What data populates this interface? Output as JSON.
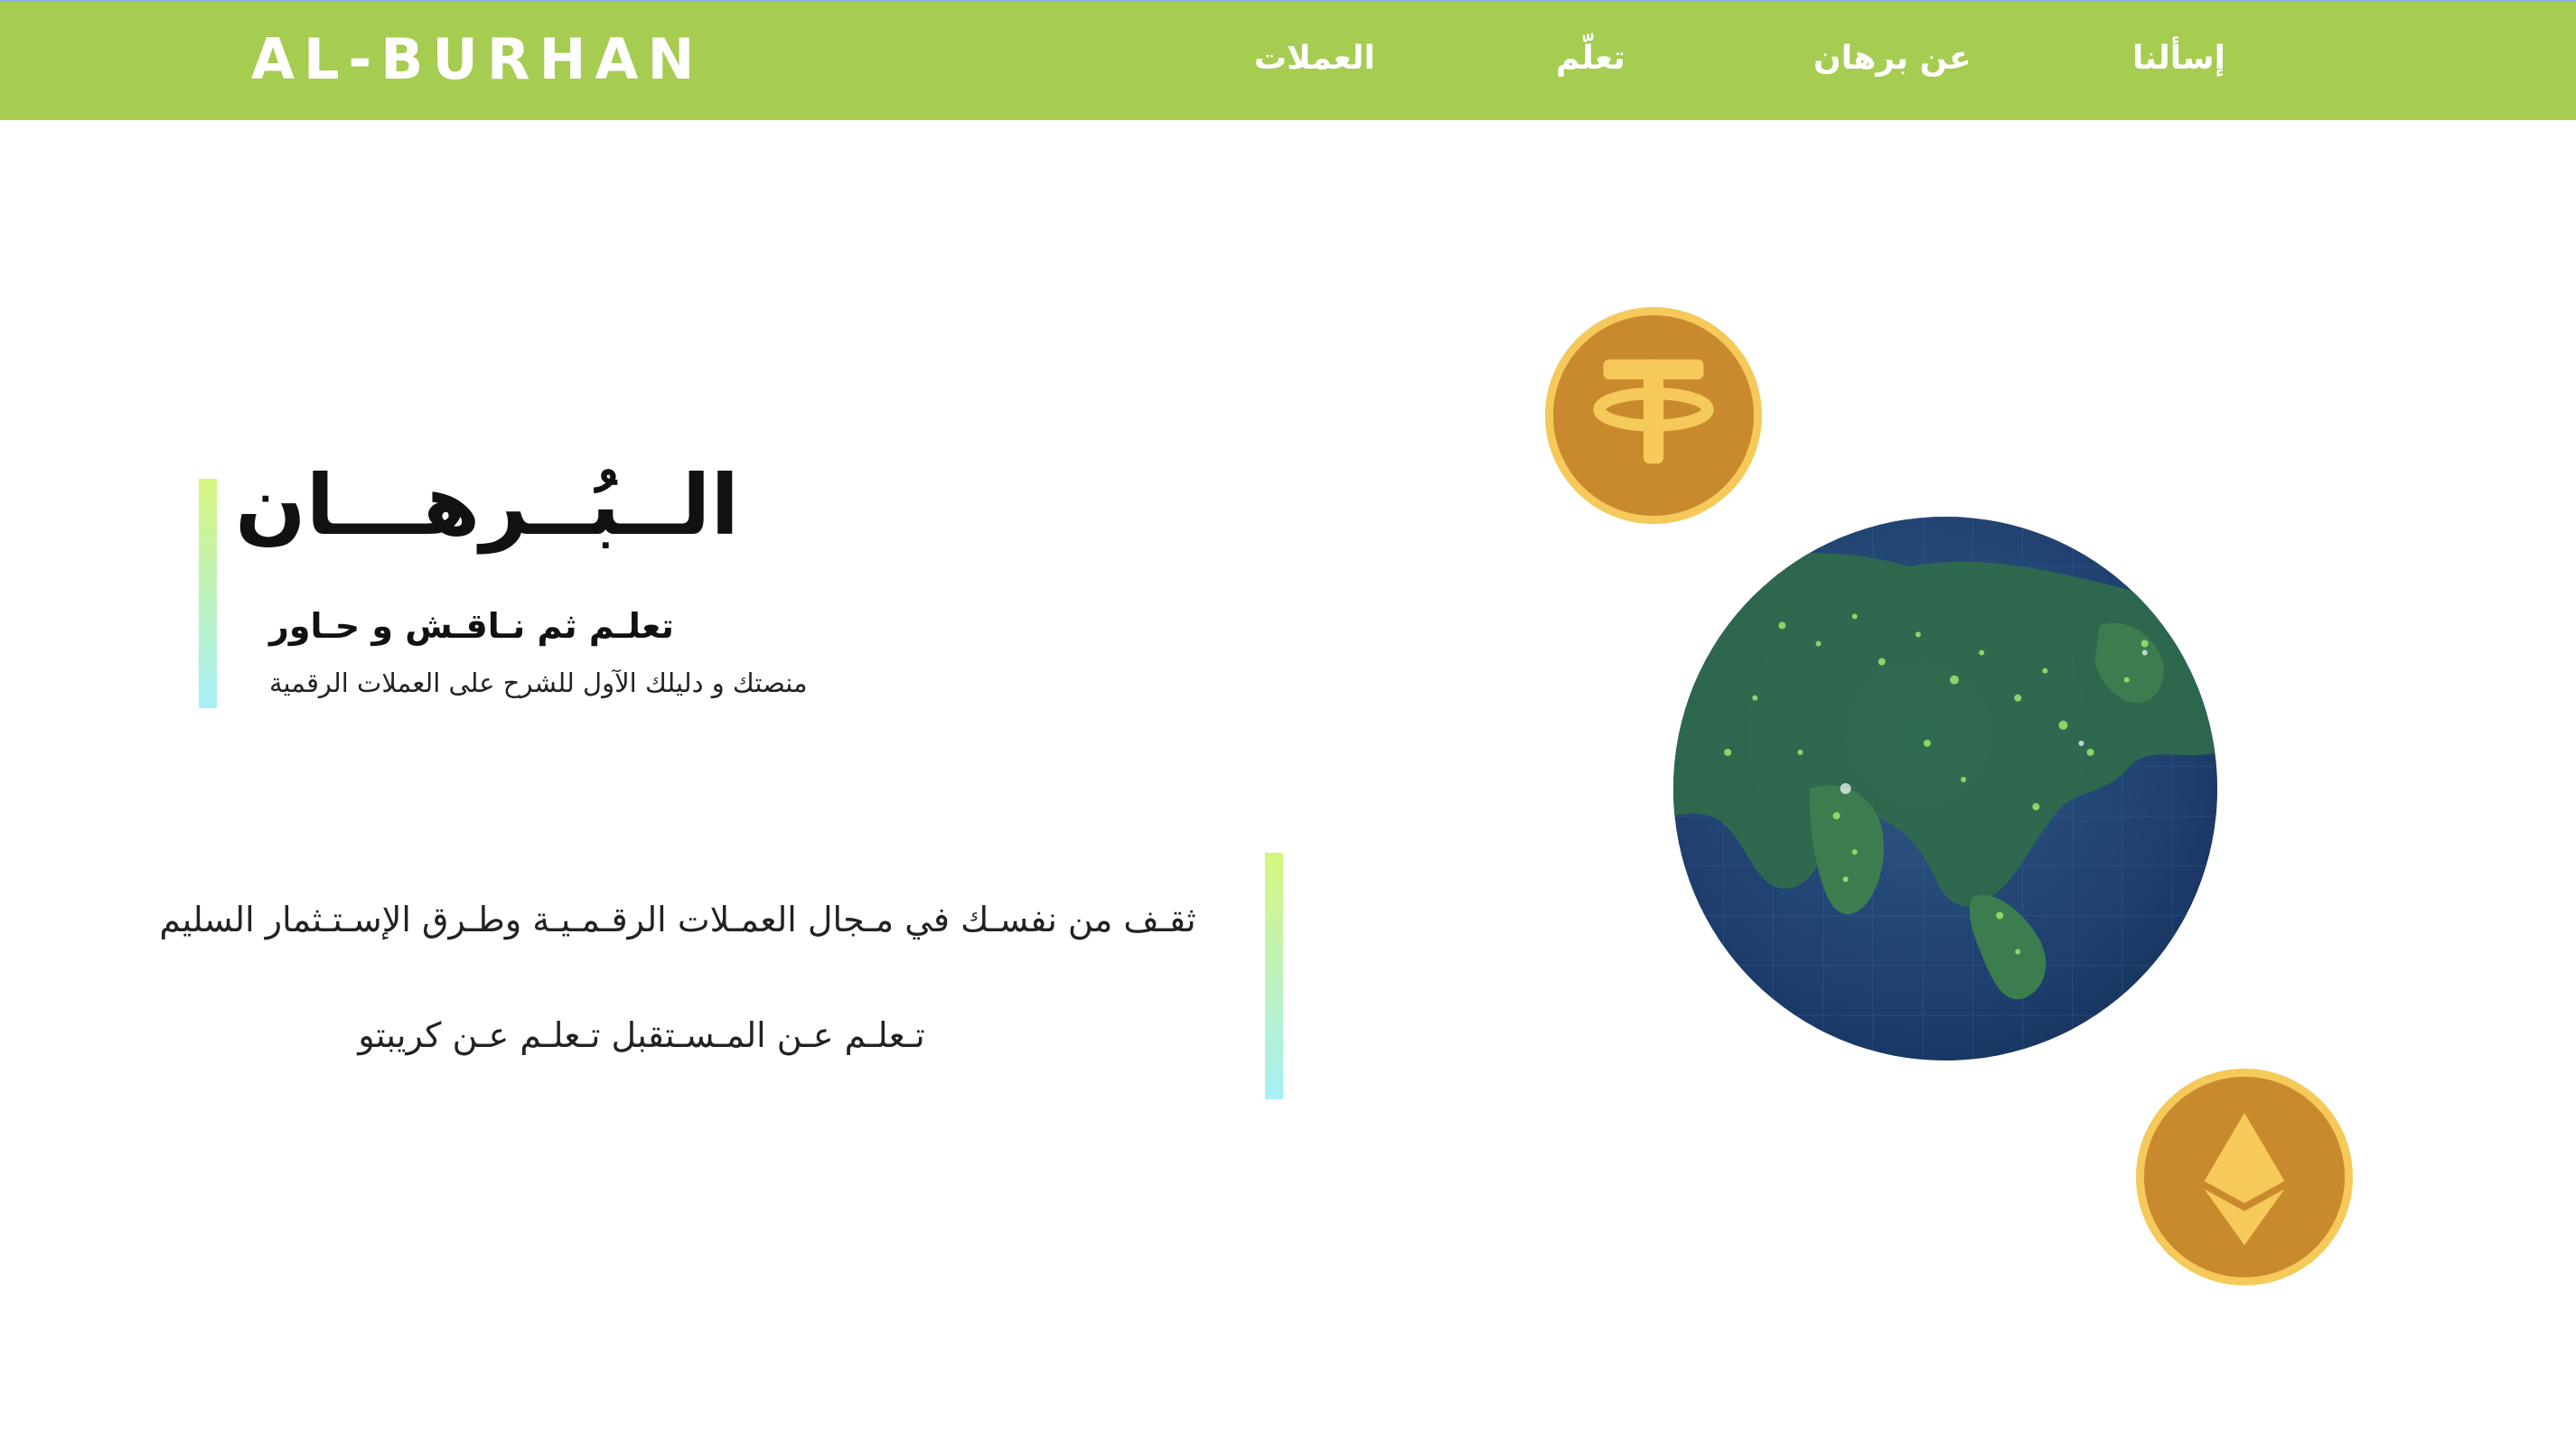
{
  "header": {
    "brand": "AL-BURHAN",
    "nav": [
      {
        "label": "إسألنا"
      },
      {
        "label": "عن برهان"
      },
      {
        "label": "تعلّم"
      },
      {
        "label": "العملات"
      }
    ]
  },
  "hero": {
    "title": "الــبُــرهـــان",
    "subtitle": "تعلـم ثم نـاقـش و حـاور",
    "description": "منصتك و دليلك الآول للشرح على العملات الرقمية"
  },
  "taglines": [
    "ثقـف من نفسـك في مـجال العمـلات الرقـمـيـة وطـرق الإسـتـثمار السليم",
    "تـعلـم عـن المـسـتقبل تـعلـم عـن كريبتو"
  ],
  "colors": {
    "header_bg": "#a6cc52",
    "accent_gradient_top": "#d6f57f",
    "accent_gradient_bottom": "#a6f0f7",
    "coin_fill": "#c98a2e",
    "coin_ring": "#f5c95a",
    "globe_ocean": "#1f3f6e",
    "globe_land": "#5fbf4a"
  },
  "icons": {
    "coin_1": "tether-coin-icon",
    "coin_2": "ethereum-coin-icon",
    "globe": "globe-illustration"
  }
}
